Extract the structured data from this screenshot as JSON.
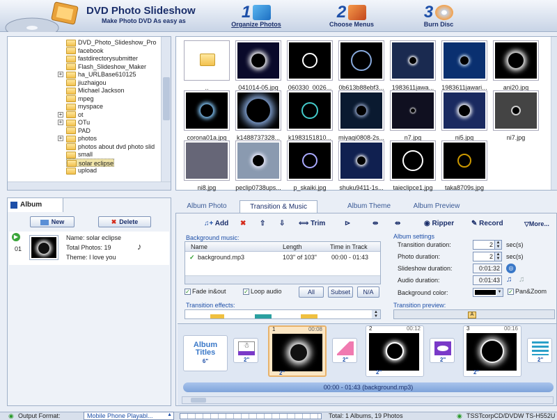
{
  "app": {
    "title": "DVD Photo Slideshow",
    "subtitle": "Make Photo DVD As easy as"
  },
  "steps": [
    {
      "num": "1",
      "label": "Organize Photos"
    },
    {
      "num": "2",
      "label": "Choose Menus"
    },
    {
      "num": "3",
      "label": "Burn Disc"
    }
  ],
  "tree": [
    "DVD_Photo_Slideshow_Pro",
    "facebook",
    "fastdirectorysubmitter",
    "Flash_Slideshow_Maker",
    "ha_URLBase610125",
    "jiuzhaigou",
    "Michael Jackson",
    "mpeg",
    "myspace",
    "ot",
    "OTu",
    "PAD",
    "photos",
    "photos about dvd  photo slid",
    "small",
    "solar eclipse",
    "upload"
  ],
  "thumbs": [
    {
      "label": ".."
    },
    {
      "label": "041014-05.jpg"
    },
    {
      "label": "060330_0026..."
    },
    {
      "label": "0b613b88ebf3..."
    },
    {
      "label": "1983611jawa..."
    },
    {
      "label": "1983611jawari..."
    },
    {
      "label": "ani20.jpg"
    },
    {
      "label": "corona01a.jpg"
    },
    {
      "label": "k1488737328..."
    },
    {
      "label": "k1983151810..."
    },
    {
      "label": "miyagi0808-2s..."
    },
    {
      "label": "n7.jpg"
    },
    {
      "label": "ni5.jpg"
    },
    {
      "label": "ni7.jpg"
    },
    {
      "label": "ni8.jpg"
    },
    {
      "label": "peclip0738ups..."
    },
    {
      "label": "p_skaiki.jpg"
    },
    {
      "label": "shuku9411-1s..."
    },
    {
      "label": "taieclipce1.jpg"
    },
    {
      "label": "taka8709s.jpg"
    }
  ],
  "album_panel": {
    "tab": "Album",
    "new_label": "New",
    "delete_label": "Delete",
    "row_num": "01",
    "name": "Name: solar eclipse",
    "total": "Total Photos: 19",
    "theme": "Theme: I love you"
  },
  "tabs": [
    "Album Photo",
    "Transition & Music",
    "Album Theme",
    "Album Preview"
  ],
  "toolbar": {
    "add": "Add",
    "trim": "Trim",
    "ripper": "Ripper",
    "record": "Record",
    "more": "More..."
  },
  "music": {
    "group": "Background music:",
    "cols": [
      "Name",
      "Length",
      "Time in Track"
    ],
    "row": {
      "name": "background.mp3",
      "length": "103\" of 103\"",
      "time": "00:00 - 01:43"
    },
    "fade": "Fade in&out",
    "loop": "Loop audio",
    "btn_all": "All",
    "btn_subset": "Subset",
    "btn_na": "N/A"
  },
  "settings": {
    "group": "Album settings",
    "transition_label": "Transition duration:",
    "transition_val": "2",
    "transition_unit": "sec(s)",
    "photo_label": "Photo duration:",
    "photo_val": "2",
    "photo_unit": "sec(s)",
    "slideshow_label": "Slideshow duration:",
    "slideshow_val": "0:01:32",
    "audio_label": "Audio duration:",
    "audio_val": "0:01:43",
    "bg_label": "Background color:",
    "panzoom": "Pan&Zoom"
  },
  "effects_group": "Transition effects:",
  "preview_group": "Transition preview:",
  "storyboard": {
    "titles_card": "Album Titles",
    "titles_dur": "6\"",
    "frames": [
      {
        "num": "1",
        "time": "00:08"
      },
      {
        "num": "2",
        "time": "00:12"
      },
      {
        "num": "3",
        "time": "00:16"
      }
    ],
    "durs": [
      "2\"",
      "2\"",
      "2\"",
      "2\"",
      "2\"",
      "2\"",
      "2\"",
      "2\""
    ],
    "timeline": "00:00 - 01:43 (background.mp3)"
  },
  "status": {
    "output_label": "Output Format:",
    "output_val": "Mobile Phone Playabl...",
    "total": "Total: 1 Albums, 19 Photos",
    "drive": "TSSTcorpCD/DVDW TS-H552U"
  }
}
